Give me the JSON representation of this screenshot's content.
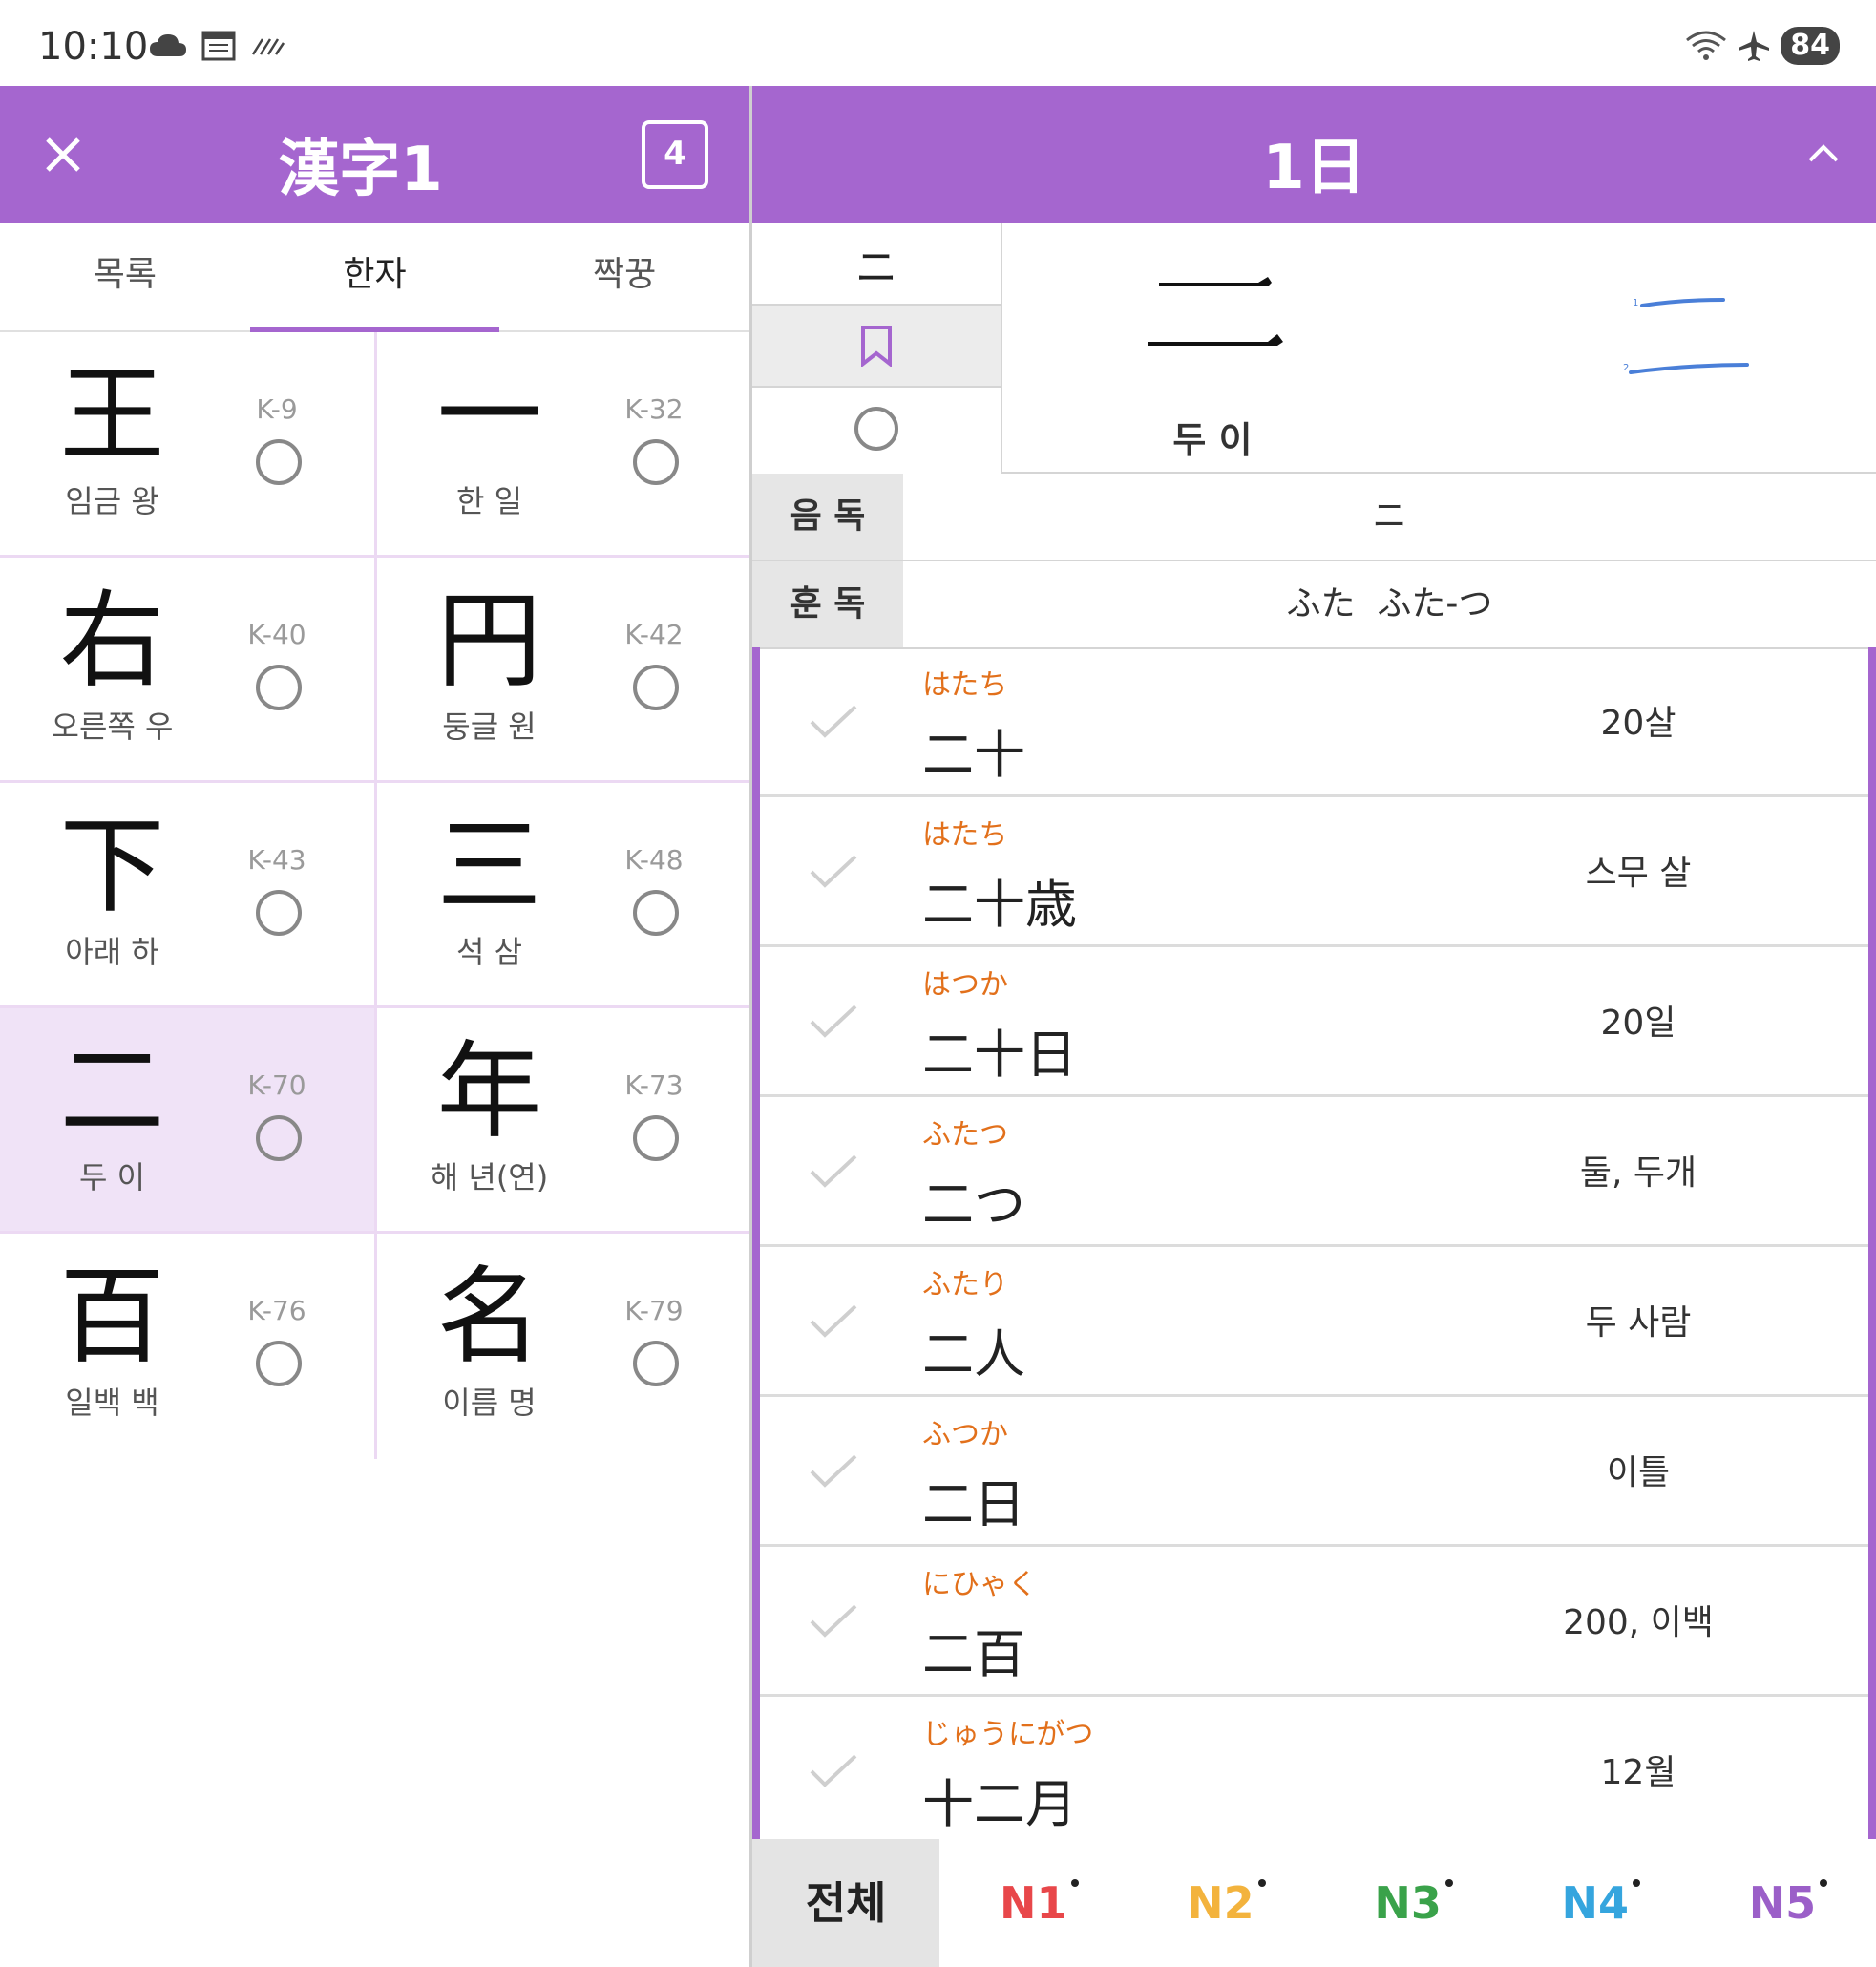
{
  "status_bar": {
    "time": "10:10",
    "battery": "84"
  },
  "left": {
    "title": "漢字1",
    "count": "4",
    "tabs": [
      {
        "label": "목록"
      },
      {
        "label": "한자"
      },
      {
        "label": "짝꿍"
      }
    ],
    "cells": [
      {
        "kanji": "王",
        "meaning": "임금 왕",
        "code": "K-9"
      },
      {
        "kanji": "一",
        "meaning": "한 일",
        "code": "K-32"
      },
      {
        "kanji": "右",
        "meaning": "오른쪽 우",
        "code": "K-40"
      },
      {
        "kanji": "円",
        "meaning": "둥글 원",
        "code": "K-42"
      },
      {
        "kanji": "下",
        "meaning": "아래 하",
        "code": "K-43"
      },
      {
        "kanji": "三",
        "meaning": "석 삼",
        "code": "K-48"
      },
      {
        "kanji": "二",
        "meaning": "두 이",
        "code": "K-70"
      },
      {
        "kanji": "年",
        "meaning": "해 년(연)",
        "code": "K-73"
      },
      {
        "kanji": "百",
        "meaning": "일백 백",
        "code": "K-76"
      },
      {
        "kanji": "名",
        "meaning": "이름 명",
        "code": "K-79"
      }
    ]
  },
  "right": {
    "title": "1日",
    "side_char": "ニ",
    "big_meaning": "두 이",
    "readings": {
      "on_label": "음 독",
      "on_value": "ニ",
      "kun_label": "훈 독",
      "kun_value": "ふた  ふた-つ"
    },
    "words": [
      {
        "reading": "はたち",
        "kanji": "二十",
        "meaning": "20살"
      },
      {
        "reading": "はたち",
        "kanji": "二十歳",
        "meaning": "스무 살"
      },
      {
        "reading": "はつか",
        "kanji": "二十日",
        "meaning": "20일"
      },
      {
        "reading": "ふたつ",
        "kanji": "二つ",
        "meaning": "둘, 두개"
      },
      {
        "reading": "ふたり",
        "kanji": "二人",
        "meaning": "두 사람"
      },
      {
        "reading": "ふつか",
        "kanji": "二日",
        "meaning": "이틀"
      },
      {
        "reading": "にひゃく",
        "kanji": "二百",
        "meaning": "200, 이백"
      },
      {
        "reading": "じゅうにがつ",
        "kanji": "十二月",
        "meaning": "12월"
      }
    ],
    "filters": {
      "all": "전체",
      "n1": "N1",
      "n2": "N2",
      "n3": "N3",
      "n4": "N4",
      "n5": "N5"
    }
  },
  "colors": {
    "header": "#a566cf",
    "reading": "#e2701b",
    "n1": "#e8474a",
    "n2": "#f3b33d",
    "n3": "#3aa24a",
    "n4": "#35a5de",
    "n5": "#9b5fc8"
  }
}
